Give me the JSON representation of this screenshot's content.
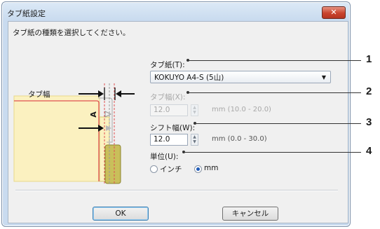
{
  "dialog": {
    "title": "タブ紙設定",
    "close_glyph": "✕",
    "instruction": "タブ紙の種類を選択してください。"
  },
  "illustration": {
    "tab_width_label": "タブ幅",
    "shape_letter": "A",
    "colors": {
      "sheet_fill": "#fbf1c0",
      "tab_fill": "#c9bf5a",
      "red_outline": "#e05050",
      "gray_outline": "#b8b8b8",
      "arrow": "#111111"
    }
  },
  "tab_paper": {
    "label": "タブ紙(T):",
    "selected": "KOKUYO A4-S (5山)"
  },
  "tab_width": {
    "label": "タブ幅(X):",
    "value": "12.0",
    "range": "mm (10.0 - 20.0)",
    "disabled": true
  },
  "shift_width": {
    "label": "シフト幅(W):",
    "value": "12.0",
    "range": "mm (0.0 - 30.0)"
  },
  "unit": {
    "label": "単位(U):",
    "options": [
      {
        "label": "インチ",
        "checked": false
      },
      {
        "label": "mm",
        "checked": true
      }
    ]
  },
  "buttons": {
    "ok": "OK",
    "cancel": "キャンセル"
  },
  "callouts": [
    "1",
    "2",
    "3",
    "4"
  ]
}
